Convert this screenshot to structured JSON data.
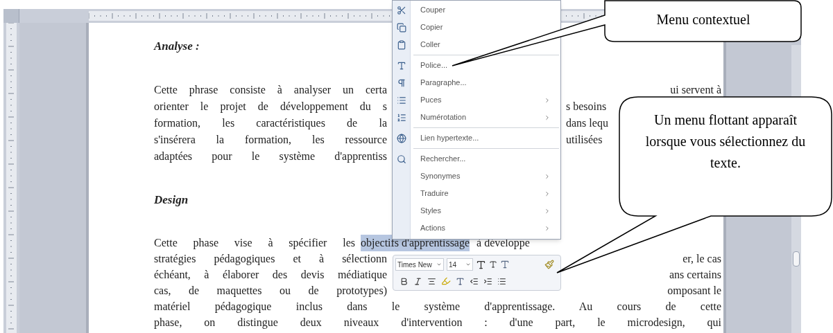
{
  "document": {
    "heading_1": "Analyse :",
    "paragraph_1": [
      {
        "left": "Cette phrase consiste à analyser un certa",
        "right": "ui servent à"
      },
      {
        "left": "orienter le projet de développement du s",
        "right": "s besoins"
      },
      {
        "left": "formation, les caractéristiques de la",
        "right": "dans lequ"
      },
      {
        "left": "s'insérera la formation, les ressource",
        "right": "utilisées"
      },
      {
        "left": "adaptées pour le système d'apprentiss"
      }
    ],
    "heading_2": "Design",
    "paragraph_2_first": {
      "left": "Cette phase vise à spécifier les",
      "selection": "objectifs d'apprentissage",
      "right": "à développe"
    },
    "paragraph_2": [
      {
        "left": "stratégies pédagogiques et à sélectionn",
        "right": "er, le cas"
      },
      {
        "left": "échéant, à élaborer des devis médiatique",
        "right": "ans certains"
      },
      {
        "left": "cas, de maquettes ou de prototypes)",
        "right": "omposant le"
      },
      {
        "left": "matériel pédagogique inclus dans le système d'apprentissage. Au cours de cette"
      },
      {
        "left": "phase, on distingue deux niveaux d'intervention : d'une part, le microdesign, qui"
      }
    ]
  },
  "context_menu": [
    {
      "kind": "item",
      "label": "Couper"
    },
    {
      "kind": "item",
      "label": "Copier"
    },
    {
      "kind": "item",
      "label": "Coller"
    },
    {
      "kind": "separator"
    },
    {
      "kind": "item",
      "label": "Police..."
    },
    {
      "kind": "item",
      "label": "Paragraphe..."
    },
    {
      "kind": "submenu",
      "label": "Puces"
    },
    {
      "kind": "submenu",
      "label": "Numérotation"
    },
    {
      "kind": "separator"
    },
    {
      "kind": "item",
      "label": "Lien hypertexte..."
    },
    {
      "kind": "separator"
    },
    {
      "kind": "item",
      "label": "Rechercher..."
    },
    {
      "kind": "submenu",
      "label": "Synonymes"
    },
    {
      "kind": "submenu",
      "label": "Traduire"
    },
    {
      "kind": "submenu",
      "label": "Styles"
    },
    {
      "kind": "submenu",
      "label": "Actions"
    }
  ],
  "mini_toolbar": {
    "font": "Times New",
    "size": "14"
  },
  "callouts": [
    {
      "text": "Menu contextuel"
    },
    {
      "text": "Un menu flottant apparaît lorsque vous sélectionnez du texte."
    }
  ]
}
